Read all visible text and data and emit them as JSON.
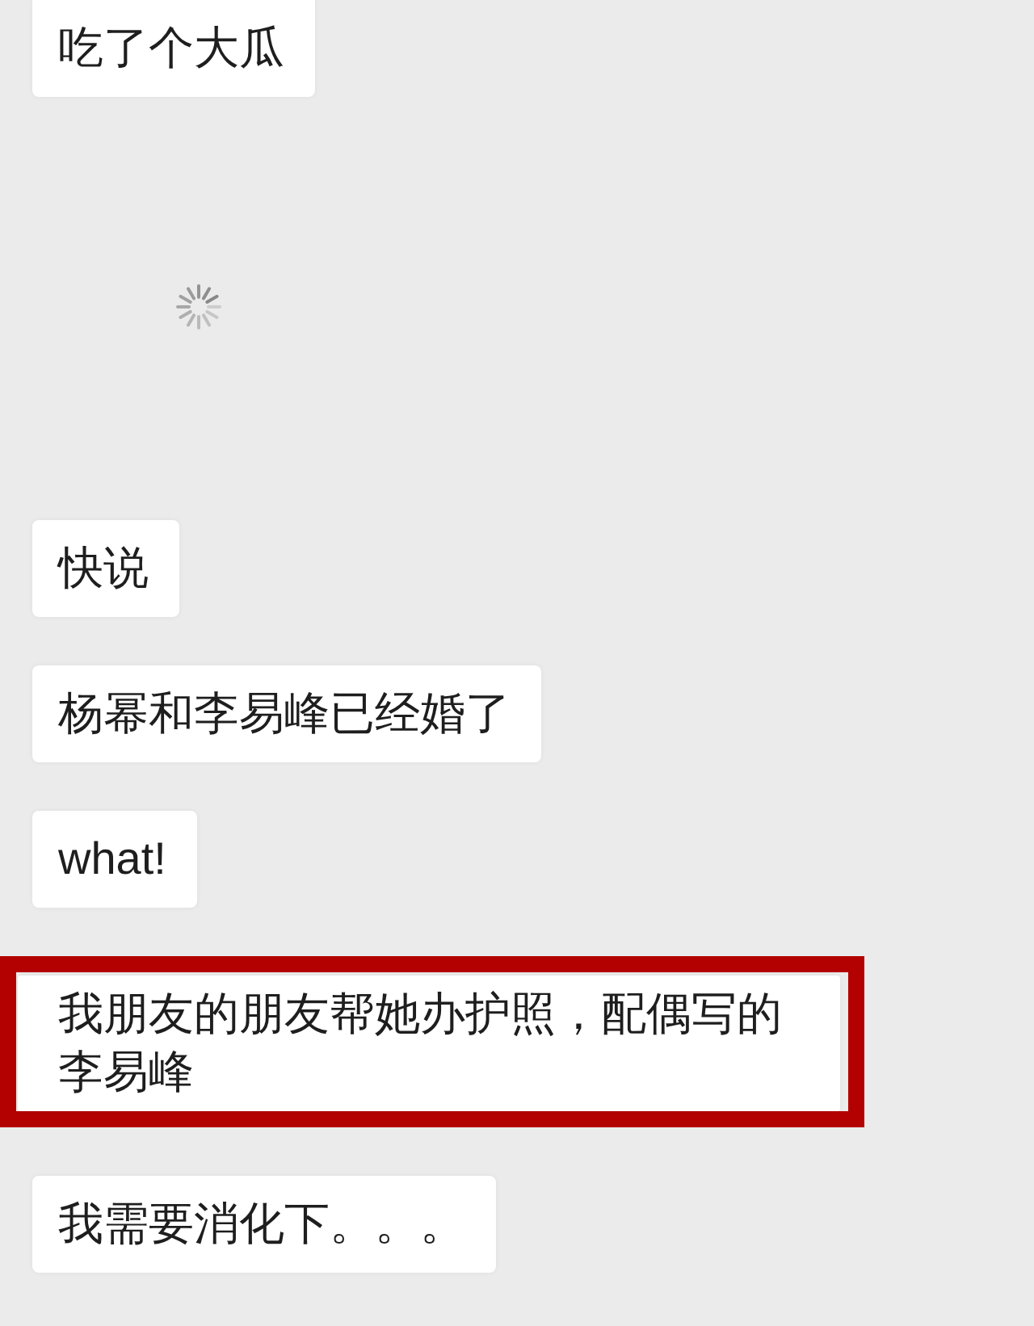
{
  "messages": [
    {
      "kind": "text",
      "text": "吃了个大瓜",
      "highlighted": false
    },
    {
      "kind": "loading"
    },
    {
      "kind": "text",
      "text": "快说",
      "highlighted": false
    },
    {
      "kind": "text",
      "text": "杨幂和李易峰已经婚了",
      "highlighted": false
    },
    {
      "kind": "text",
      "text": "what!",
      "highlighted": false
    },
    {
      "kind": "text",
      "text": "我朋友的朋友帮她办护照，配偶写的李易峰",
      "highlighted": true
    },
    {
      "kind": "text",
      "text": "我需要消化下。。。",
      "highlighted": false
    }
  ]
}
